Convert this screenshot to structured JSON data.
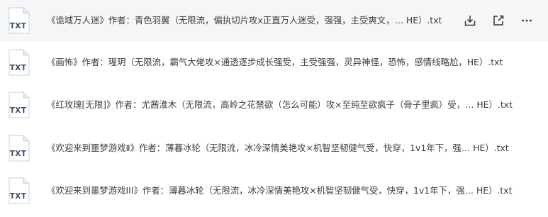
{
  "files": [
    {
      "name": "《诡域万人迷》作者：青色羽翼（无限流，偏执切片攻x正直万人迷受，强强，主受爽文，… HE）.txt",
      "icon_label": "TXT",
      "icon": "txt-file-icon"
    },
    {
      "name": "《画怖》作者：瑆玥（无限流，霸气大佬攻×通透逐步成长强受，主受强强，灵异神怪，恐怖，感情线略尬，HE）.txt",
      "icon_label": "TXT",
      "icon": "txt-file-icon"
    },
    {
      "name": "《红玫瑰[无限]》作者：尤茜淮木（无限流，高岭之花禁欲（怎么可能）攻×至纯至欲疯子（骨子里疯）受，… HE）.txt",
      "icon_label": "TXT",
      "icon": "txt-file-icon"
    },
    {
      "name": "《欢迎来到噩梦游戏Ⅱ》作者：薄暮冰轮（无限流，冰冷深情美艳攻×机智坚韧健气受，快穿，1v1年下，强… HE）.txt",
      "icon_label": "TXT",
      "icon": "txt-file-icon"
    },
    {
      "name": "《欢迎来到噩梦游戏III》作者：薄暮冰轮（无限流，冰冷深情美艳攻×机智坚韧健气受，快穿，1v1年下，强… HE）.txt",
      "icon_label": "TXT",
      "icon": "txt-file-icon"
    }
  ],
  "row_actions": {
    "download": "download-icon",
    "share": "share-icon",
    "more": "more-icon"
  },
  "colors": {
    "row_hover": "#f5f6f8",
    "text": "#3c3c3c",
    "icon_stroke": "#3d4d66",
    "icon_fill": "#e8ecf2"
  }
}
